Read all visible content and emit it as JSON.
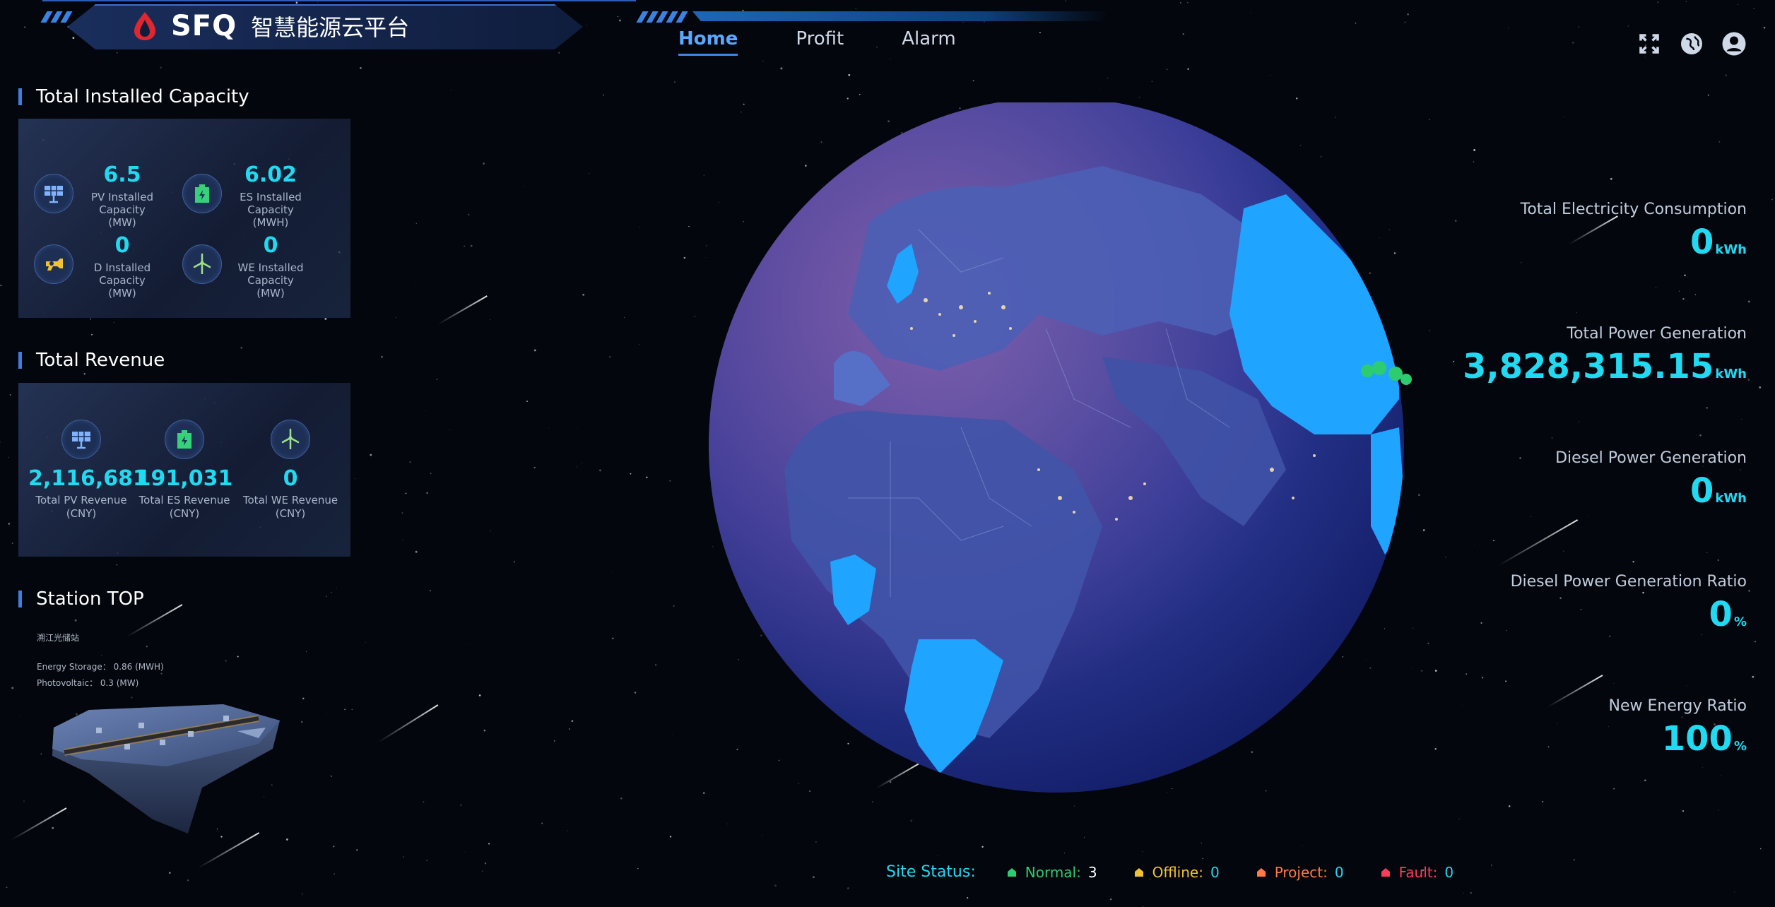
{
  "header": {
    "brand": "SFQ",
    "platform_name": "智慧能源云平台",
    "nav": [
      {
        "label": "Home",
        "active": true
      },
      {
        "label": "Profit",
        "active": false
      },
      {
        "label": "Alarm",
        "active": false
      }
    ],
    "tools": [
      "fullscreen-icon",
      "globe-icon",
      "user-icon"
    ]
  },
  "capacity": {
    "title": "Total Installed Capacity",
    "items": [
      {
        "icon": "solar-panel-icon",
        "value": "6.5",
        "label": "PV Installed Capacity",
        "unit": "(MW)"
      },
      {
        "icon": "battery-storage-icon",
        "value": "6.02",
        "label": "ES Installed Capacity",
        "unit": "(MWH)"
      },
      {
        "icon": "diesel-generator-icon",
        "value": "0",
        "label": "D Installed Capacity",
        "unit": "(MW)"
      },
      {
        "icon": "wind-turbine-icon",
        "value": "0",
        "label": "WE Installed Capacity",
        "unit": "(MW)"
      }
    ]
  },
  "revenue": {
    "title": "Total Revenue",
    "items": [
      {
        "icon": "solar-panel-icon",
        "value": "2,116,681",
        "label": "Total PV Revenue",
        "unit": "(CNY)"
      },
      {
        "icon": "battery-storage-icon",
        "value": "191,031",
        "label": "Total ES Revenue",
        "unit": "(CNY)"
      },
      {
        "icon": "wind-turbine-icon",
        "value": "0",
        "label": "Total WE Revenue",
        "unit": "(CNY)"
      }
    ]
  },
  "station": {
    "title": "Station TOP",
    "name": "溯江光储站",
    "energy_storage": "Energy Storage： 0.86  (MWH)",
    "photovoltaic": "Photovoltaic： 0.3  (MW)"
  },
  "kpis": [
    {
      "label": "Total Electricity Consumption",
      "value": "0",
      "unit": "kWh"
    },
    {
      "label": "Total Power Generation",
      "value": "3,828,315.15",
      "unit": "kWh"
    },
    {
      "label": "Diesel Power Generation",
      "value": "0",
      "unit": "kWh"
    },
    {
      "label": "Diesel Power Generation Ratio",
      "value": "0",
      "unit": "%"
    },
    {
      "label": "New Energy Ratio",
      "value": "100",
      "unit": "%"
    }
  ],
  "site_status": {
    "title": "Site Status:",
    "items": [
      {
        "label": "Normal:",
        "value": "3",
        "color": "#2ecc71"
      },
      {
        "label": "Offline:",
        "value": "0",
        "color": "#f1c232"
      },
      {
        "label": "Project:",
        "value": "0",
        "color": "#ff7a45"
      },
      {
        "label": "Fault:",
        "value": "0",
        "color": "#ff3b5c"
      }
    ]
  },
  "colors": {
    "accent": "#21d9f0",
    "nav_active": "#5aa9ff",
    "background": "#03060c"
  }
}
